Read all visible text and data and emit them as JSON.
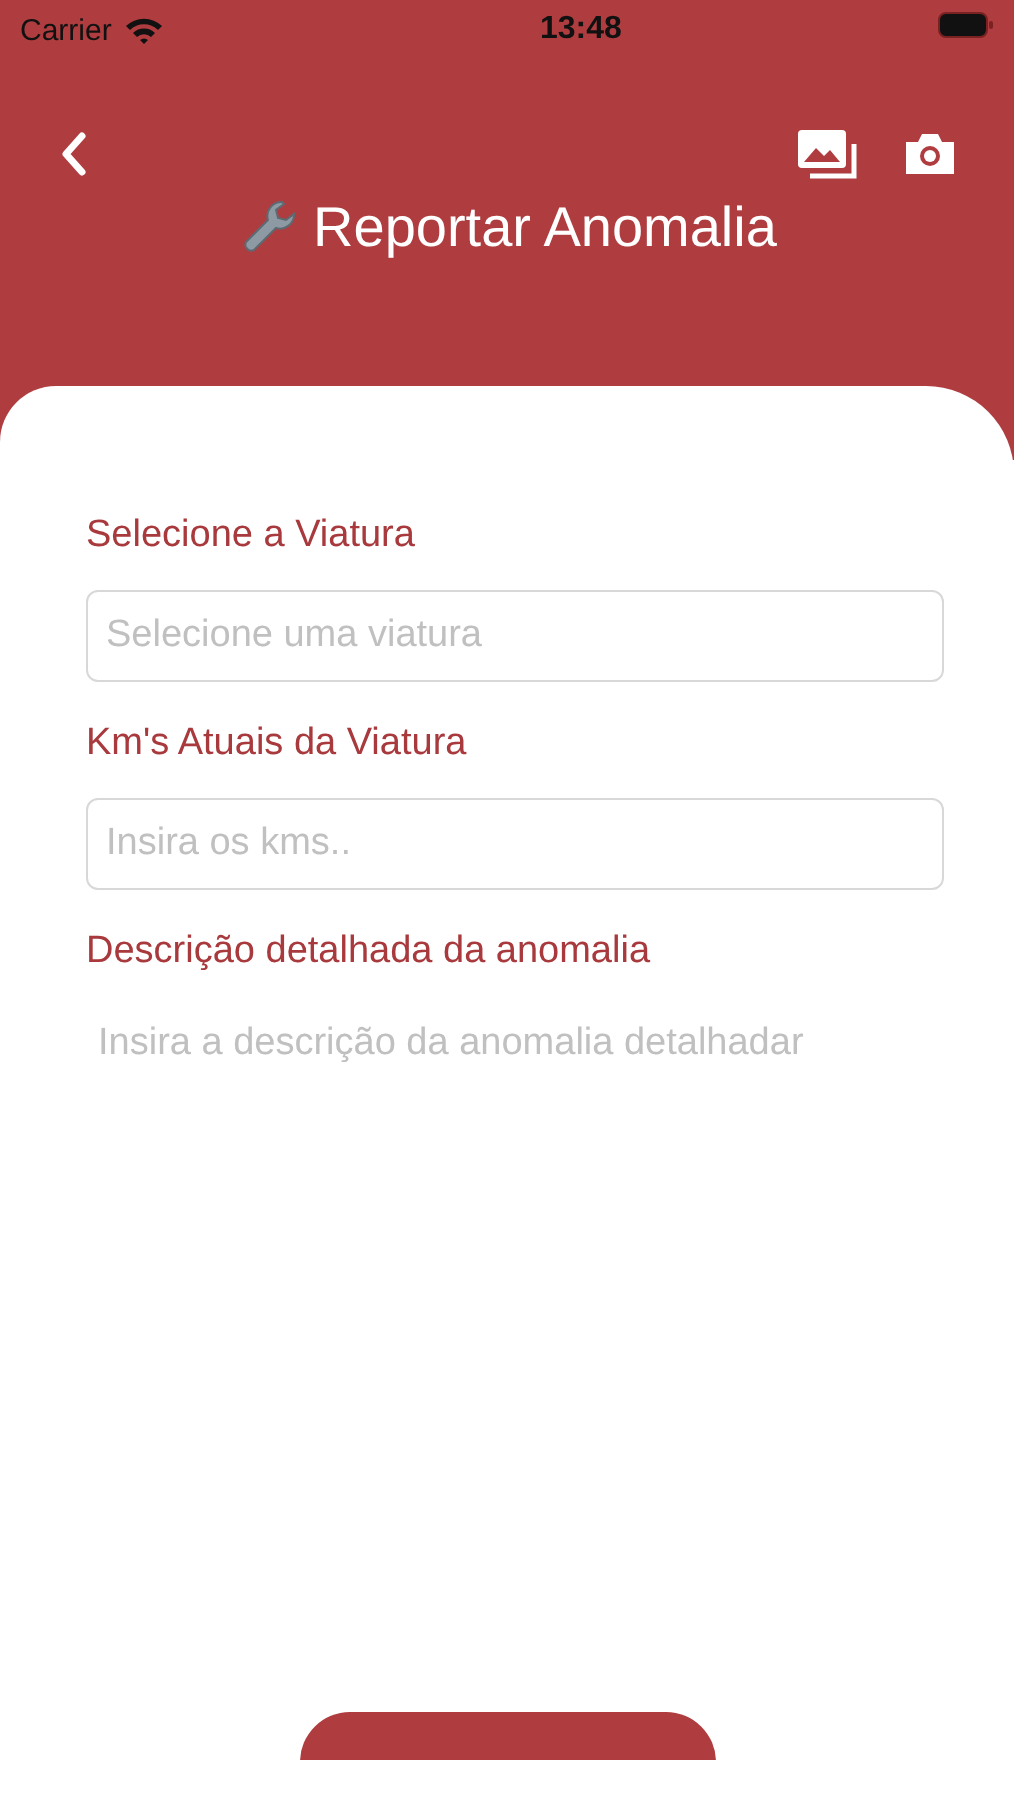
{
  "status_bar": {
    "carrier": "Carrier",
    "time": "13:48"
  },
  "header": {
    "title": "Reportar Anomalia"
  },
  "fields": [
    {
      "kind": "select",
      "label": "Selecione a Viatura",
      "placeholder": "Selecione uma viatura"
    },
    {
      "kind": "input",
      "label": "Km's Atuais da Viatura",
      "placeholder": "Insira os kms.."
    },
    {
      "kind": "textarea",
      "label": "Descrição detalhada da anomalia",
      "placeholder": "Insira a descrição da anomalia detalhadar"
    }
  ]
}
